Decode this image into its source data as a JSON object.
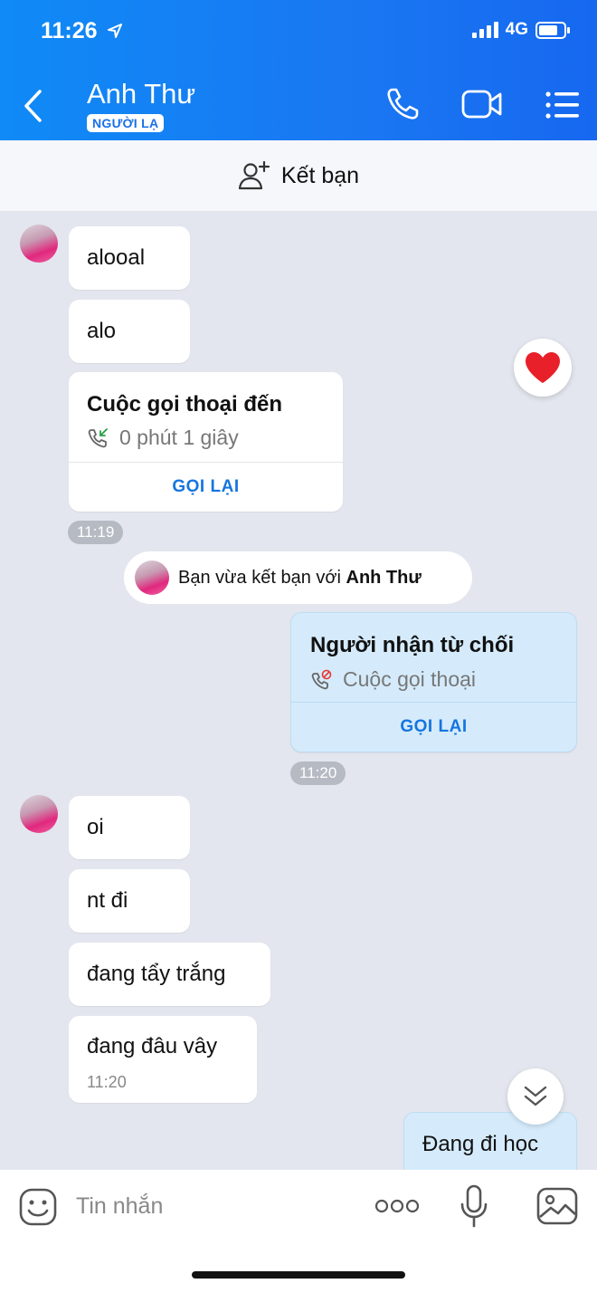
{
  "status": {
    "time": "11:26",
    "network": "4G"
  },
  "header": {
    "name": "Anh Thư",
    "badge": "NGƯỜI LẠ"
  },
  "add_friend": {
    "label": "Kết bạn"
  },
  "messages": {
    "m1": "alooal",
    "m2": "alo",
    "call_in": {
      "title": "Cuộc gọi thoại đến",
      "duration": "0 phút 1 giây",
      "action": "GỌI LẠI"
    },
    "t1": "11:19",
    "system": {
      "prefix": "Bạn vừa kết bạn với ",
      "name": "Anh Thư"
    },
    "call_out": {
      "title": "Người nhận từ chối",
      "detail": "Cuộc gọi thoại",
      "action": "GỌI LẠI"
    },
    "t2": "11:20",
    "m3": "oi",
    "m4": "nt đi",
    "m5": "đang tẩy trắng",
    "m6": "đang đâu vây",
    "m6_time": "11:20",
    "m7": "Đang đi học"
  },
  "input": {
    "placeholder": "Tin nhắn"
  },
  "colors": {
    "header_blue": "#1a77f2",
    "action_blue": "#1675e0",
    "my_bubble": "#d5ebfb",
    "heart": "#e8202a"
  },
  "icons": [
    "back-icon",
    "phone-icon",
    "video-icon",
    "menu-icon",
    "add-friend-icon",
    "incoming-call-icon",
    "missed-call-icon",
    "heart-icon",
    "chevron-down-icon",
    "sticker-icon",
    "more-icon",
    "mic-icon",
    "image-icon"
  ]
}
